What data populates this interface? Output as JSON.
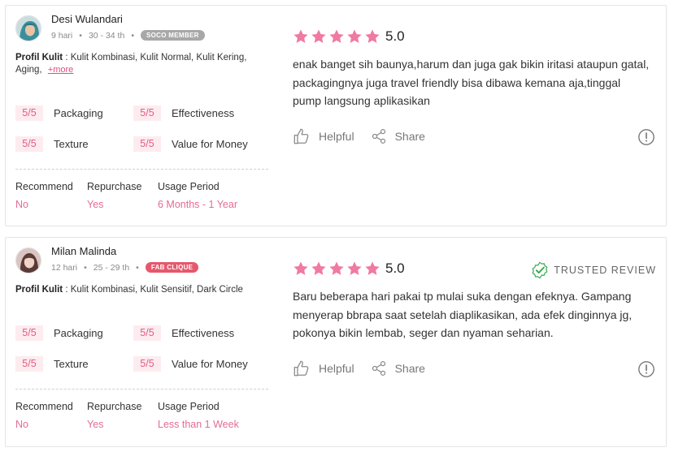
{
  "colors": {
    "accent_pink": "#e56b92",
    "star_pink": "#f07aa0",
    "score_bg": "#fdecef",
    "soco_member_badge": "#a8a8a8",
    "fab_clique_badge": "#e5586c",
    "trusted_green": "#3fae58"
  },
  "labels": {
    "profile_label": "Profil Kulit",
    "more": "+more",
    "helpful": "Helpful",
    "share": "Share",
    "trusted_review": "TRUSTED REVIEW"
  },
  "reviews": [
    {
      "user": {
        "name": "Desi Wulandari",
        "time": "9 hari",
        "age_range": "30 - 34 th",
        "badge": "SOCO MEMBER",
        "avatar_icon": "avatar-hijab-icon"
      },
      "skin_profile": ": Kulit Kombinasi, Kulit Normal, Kulit Kering, Aging,",
      "show_more": true,
      "ratings": [
        {
          "score": "5/5",
          "label": "Packaging"
        },
        {
          "score": "5/5",
          "label": "Effectiveness"
        },
        {
          "score": "5/5",
          "label": "Texture"
        },
        {
          "score": "5/5",
          "label": "Value for Money"
        }
      ],
      "usage": [
        {
          "label": "Recommend",
          "value": "No"
        },
        {
          "label": "Repurchase",
          "value": "Yes"
        },
        {
          "label": "Usage Period",
          "value": "6 Months - 1 Year"
        }
      ],
      "stars": 5,
      "score": "5.0",
      "trusted": false,
      "text": "enak banget sih baunya,harum dan juga gak bikin iritasi ataupun gatal, packagingnya juga travel friendly bisa dibawa kemana aja,tinggal pump langsung aplikasikan"
    },
    {
      "user": {
        "name": "Milan Malinda",
        "time": "12 hari",
        "age_range": "25 - 29 th",
        "badge": "FAB CLIQUE",
        "avatar_icon": "avatar-portrait-icon"
      },
      "skin_profile": ": Kulit Kombinasi, Kulit Sensitif, Dark Circle",
      "show_more": false,
      "ratings": [
        {
          "score": "5/5",
          "label": "Packaging"
        },
        {
          "score": "5/5",
          "label": "Effectiveness"
        },
        {
          "score": "5/5",
          "label": "Texture"
        },
        {
          "score": "5/5",
          "label": "Value for Money"
        }
      ],
      "usage": [
        {
          "label": "Recommend",
          "value": "No"
        },
        {
          "label": "Repurchase",
          "value": "Yes"
        },
        {
          "label": "Usage Period",
          "value": "Less than 1 Week"
        }
      ],
      "stars": 5,
      "score": "5.0",
      "trusted": true,
      "text": "Baru beberapa hari pakai tp mulai suka dengan efeknya. Gampang menyerap bbrapa saat setelah diaplikasikan, ada efek dinginnya jg, pokonya bikin lembab, seger dan nyaman seharian."
    }
  ]
}
